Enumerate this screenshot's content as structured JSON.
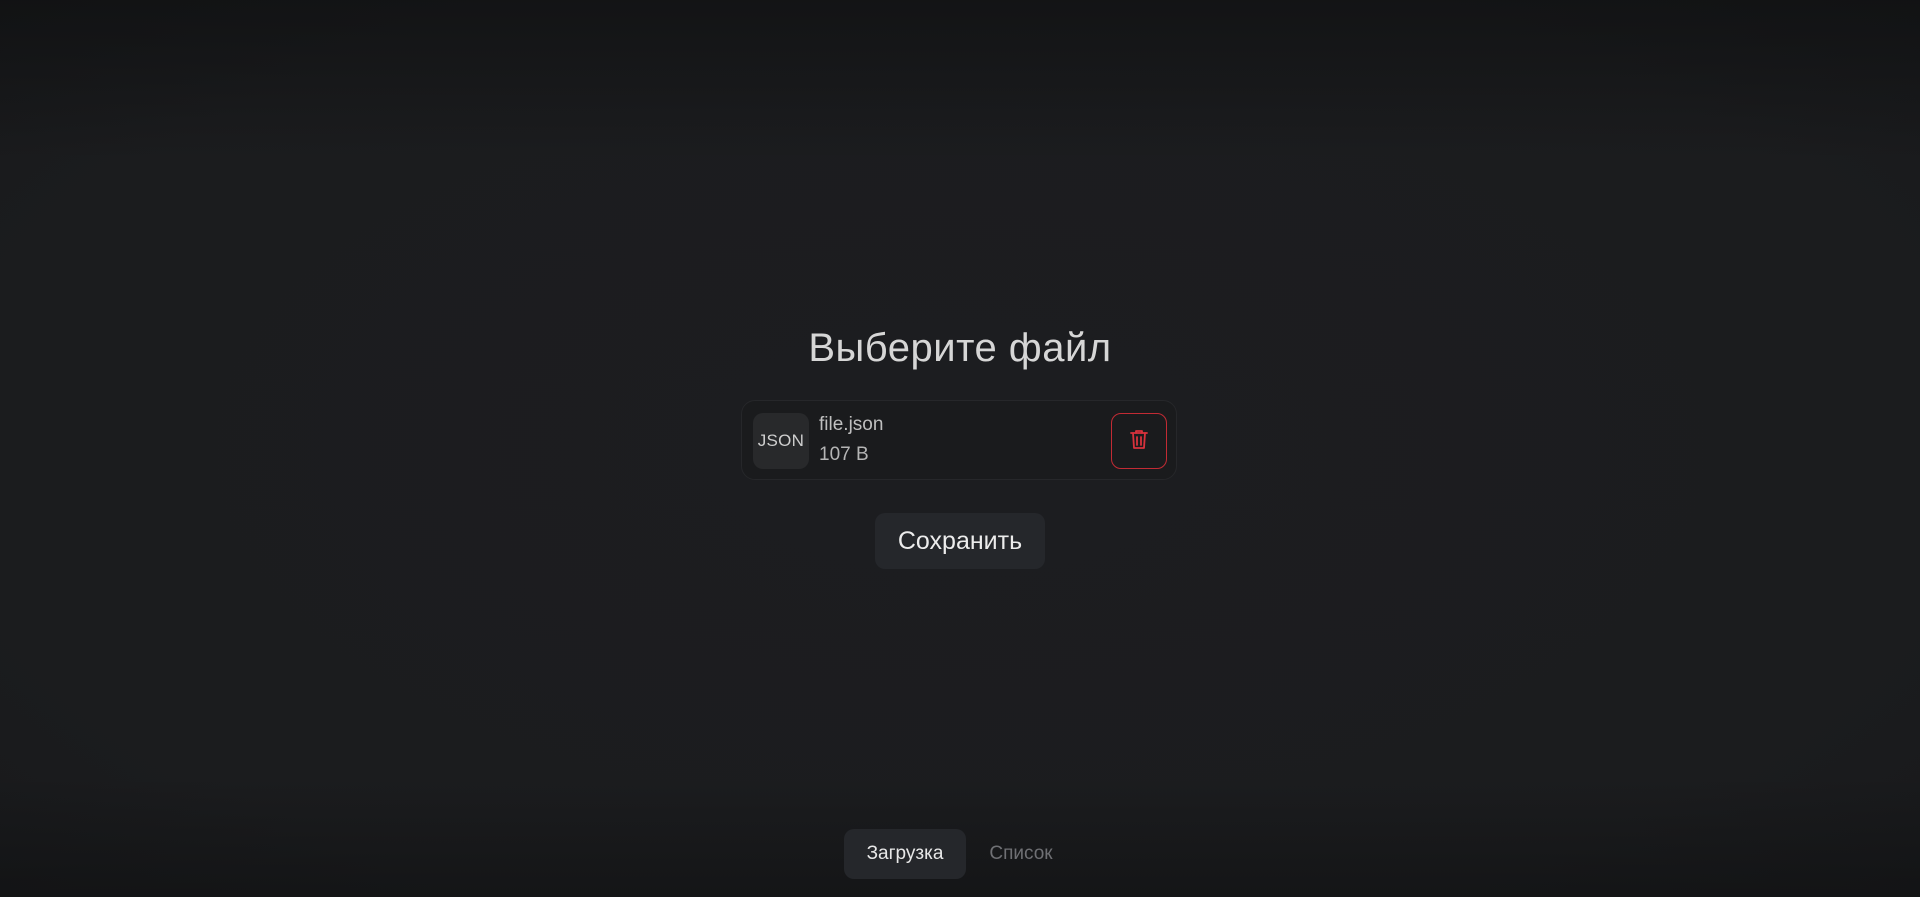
{
  "page": {
    "title": "Выберите файл"
  },
  "file_card": {
    "type_badge": "JSON",
    "file_name": "file.json",
    "file_size": "107 B",
    "delete_icon": "trash-icon"
  },
  "actions": {
    "save_label": "Сохранить"
  },
  "bottom_nav": {
    "tabs": [
      {
        "label": "Загрузка",
        "active": true
      },
      {
        "label": "Список",
        "active": false
      }
    ]
  },
  "colors": {
    "background": "#1b1c1e",
    "danger": "#c22b34",
    "button_bg": "#25272b"
  }
}
